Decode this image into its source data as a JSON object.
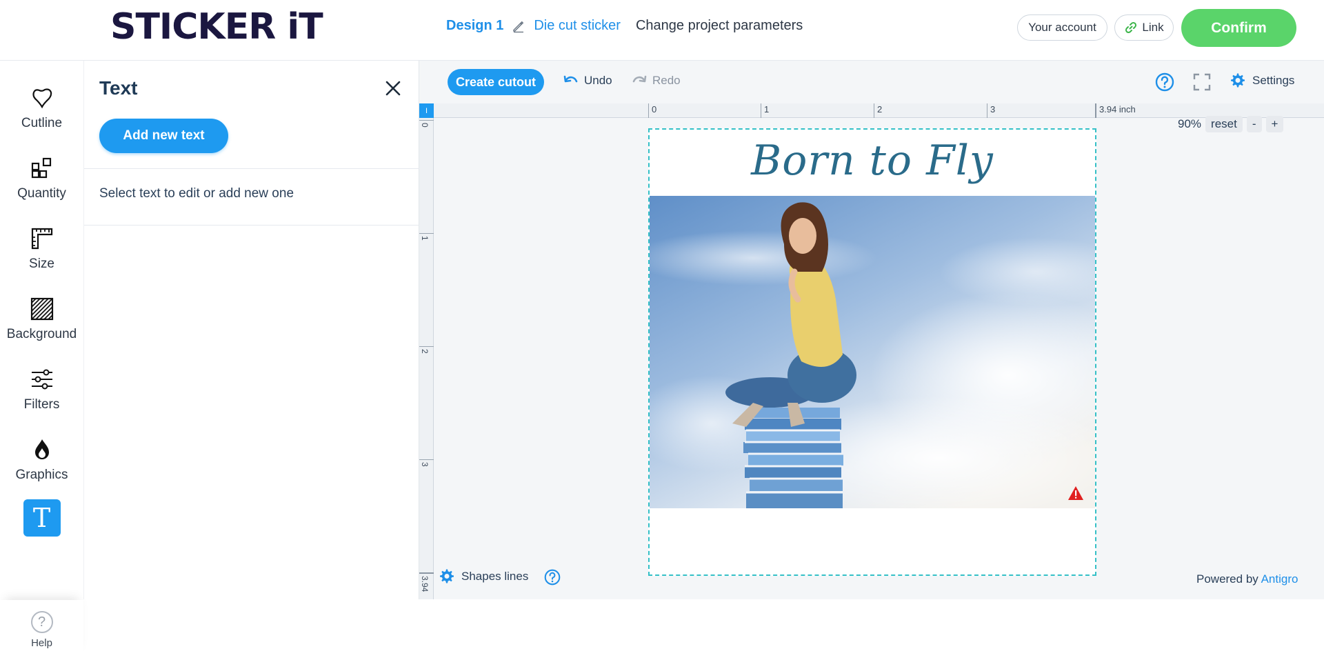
{
  "header": {
    "logo": "STICKER iT",
    "design_name": "Design 1",
    "product": "Die cut sticker",
    "change_params": "Change project parameters",
    "account": "Your account",
    "link": "Link",
    "confirm": "Confirm"
  },
  "tools": {
    "cutline": "Cutline",
    "quantity": "Quantity",
    "size": "Size",
    "background": "Background",
    "filters": "Filters",
    "graphics": "Graphics",
    "text_glyph": "T",
    "help": "Help",
    "help_glyph": "?"
  },
  "panel": {
    "title": "Text",
    "add_button": "Add new text",
    "hint": "Select text to edit or add new one"
  },
  "toolbar": {
    "cutout": "Create cutout",
    "undo": "Undo",
    "redo": "Redo",
    "settings": "Settings"
  },
  "ruler": {
    "corner": "I",
    "h": [
      "0",
      "1",
      "2",
      "3"
    ],
    "h_end": "3.94 inch",
    "v": [
      "0",
      "1",
      "2",
      "3"
    ],
    "v_end": "3.94"
  },
  "zoom": {
    "level": "90%",
    "reset": "reset",
    "minus": "-",
    "plus": "+"
  },
  "canvas": {
    "title": "Born to Fly"
  },
  "footer": {
    "shapes_lines": "Shapes lines",
    "powered_by": "Powered by",
    "powered_brand": "Antigro"
  },
  "colors": {
    "accent": "#1e9af0",
    "confirm": "#5ad46a",
    "cut_line": "#34c0c7"
  }
}
